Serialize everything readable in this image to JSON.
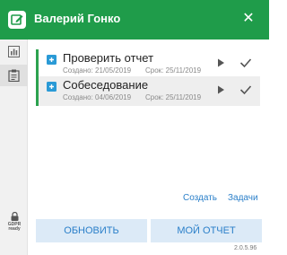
{
  "header": {
    "title": "Валерий Гонко",
    "close_symbol": "✕",
    "icon": "edit-note-icon"
  },
  "sidebar": {
    "items": [
      {
        "name": "stats",
        "icon": "bar-chart-icon"
      },
      {
        "name": "tasks",
        "icon": "clipboard-icon",
        "active": true
      }
    ],
    "gdpr": {
      "line1": "GDPR",
      "line2": "ready"
    }
  },
  "tasks": [
    {
      "title": "Проверить отчет",
      "created": "Создано: 21/05/2019",
      "due": "Срок: 25/11/2019",
      "play_icon": "play-icon",
      "done_icon": "check-icon"
    },
    {
      "title": "Собеседование",
      "created": "Создано: 04/06/2019",
      "due": "Срок: 25/11/2019",
      "play_icon": "play-icon",
      "done_icon": "check-icon"
    }
  ],
  "links": {
    "create": "Создать",
    "tasks": "Задачи"
  },
  "buttons": {
    "refresh": "ОБНОВИТЬ",
    "my_report": "МОЙ ОТЧЕТ"
  },
  "version": "2.0.5.96",
  "colors": {
    "brand": "#1f9c4a",
    "accent": "#2a7fc9",
    "button_bg": "#dceaf7",
    "task_bar": "#2ca24f"
  }
}
